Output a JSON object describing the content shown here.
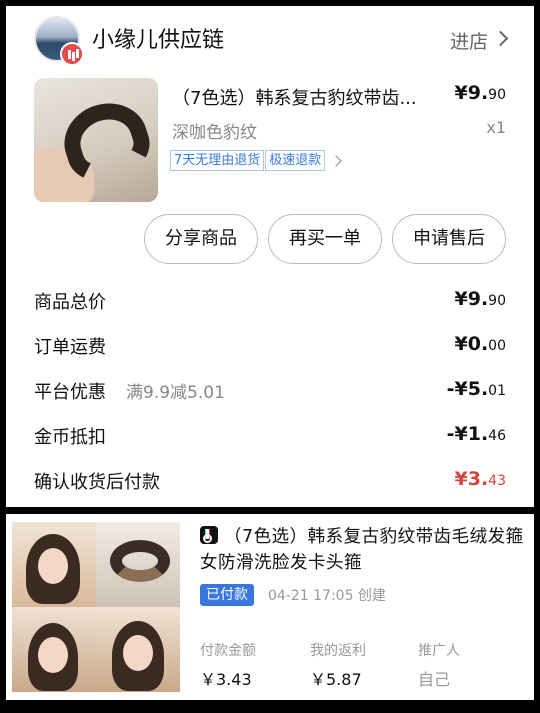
{
  "shop": {
    "name": "小缘儿供应链",
    "enter_label": "进店"
  },
  "product": {
    "title": "（7色选）韩系复古豹纹带齿...",
    "price_main": "¥9.",
    "price_decimal": "90",
    "variant": "深咖色豹纹",
    "quantity": "x1",
    "tags": [
      "7天无理由退货",
      "极速退款"
    ]
  },
  "actions": {
    "share": "分享商品",
    "rebuy": "再买一单",
    "after_sale": "申请售后"
  },
  "summary": [
    {
      "label": "商品总价",
      "extra": "",
      "value_main": "¥9.",
      "value_decimal": "90"
    },
    {
      "label": "订单运费",
      "extra": "",
      "value_main": "¥0.",
      "value_decimal": "00"
    },
    {
      "label": "平台优惠",
      "extra": "满9.9减5.01",
      "value_main": "-¥5.",
      "value_decimal": "01"
    },
    {
      "label": "金币抵扣",
      "extra": "",
      "value_main": "-¥1.",
      "value_decimal": "46"
    },
    {
      "label": "确认收货后付款",
      "extra": "",
      "value_main": "¥3.",
      "value_decimal": "43"
    }
  ],
  "order": {
    "title": "（7色选）韩系复古豹纹带齿毛绒发箍女防滑洗脸发卡头箍",
    "status": "已付款",
    "time": "04-21 17:05 创建",
    "paid_label": "付款金额",
    "paid_value": "￥3.43",
    "rebate_label": "我的返利",
    "rebate_value": "￥5.87",
    "promoter_label": "推广人",
    "promoter_value": "自己"
  },
  "colors": {
    "accent_blue": "#3a76e0",
    "price_red": "#d6453c"
  }
}
